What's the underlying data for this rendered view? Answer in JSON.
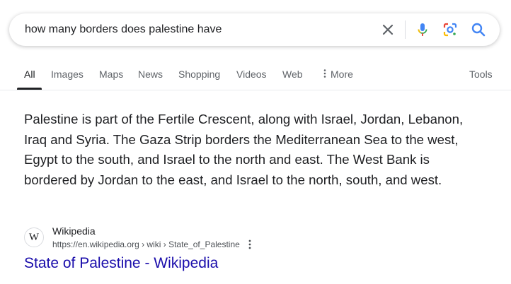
{
  "search": {
    "query": "how many borders does palestine have"
  },
  "tabs": [
    {
      "label": "All",
      "active": true
    },
    {
      "label": "Images"
    },
    {
      "label": "Maps"
    },
    {
      "label": "News"
    },
    {
      "label": "Shopping"
    },
    {
      "label": "Videos"
    },
    {
      "label": "Web"
    },
    {
      "label": "More"
    }
  ],
  "tools_label": "Tools",
  "snippet": {
    "text": "Palestine is part of the Fertile Crescent, along with Israel, Jordan, Lebanon, Iraq and Syria. The Gaza Strip borders the Mediterranean Sea to the west, Egypt to the south, and Israel to the north and east. The West Bank is bordered by Jordan to the east, and Israel to the north, south, and west."
  },
  "source": {
    "favicon_letter": "W",
    "site_name": "Wikipedia",
    "url": "https://en.wikipedia.org › wiki › State_of_Palestine",
    "title": "State of Palestine - Wikipedia"
  },
  "colors": {
    "link": "#1a0dab",
    "mic_blue": "#4285f4",
    "mic_red": "#ea4335",
    "lens_yellow": "#fbbc04",
    "lens_green": "#34a853"
  },
  "icons": [
    "clear-icon",
    "mic-icon",
    "lens-icon",
    "search-icon",
    "more-vert-icon"
  ]
}
